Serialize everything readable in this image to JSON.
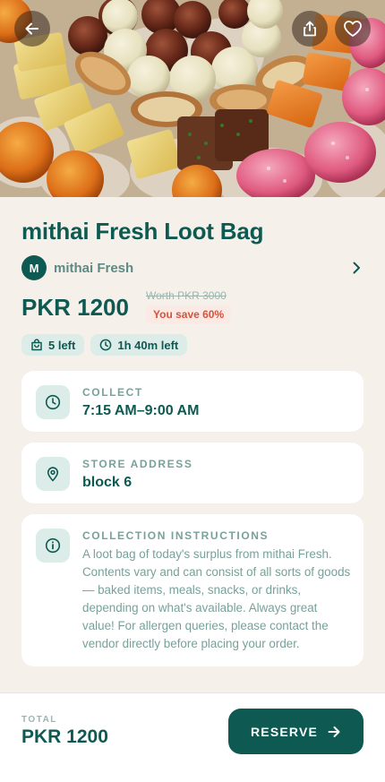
{
  "product": {
    "title": "mithai Fresh Loot Bag",
    "vendor": {
      "initial": "M",
      "name": "mithai Fresh"
    },
    "price": "PKR 1200",
    "worth": "Worth PKR 3000",
    "savings": "You save 60%",
    "chips": {
      "left": "5 left",
      "time_left": "1h 40m left"
    }
  },
  "details": {
    "collect": {
      "label": "COLLECT",
      "value": "7:15 AM–9:00 AM"
    },
    "address": {
      "label": "STORE ADDRESS",
      "value": "block 6"
    },
    "instructions": {
      "label": "COLLECTION INSTRUCTIONS",
      "text": "A loot bag of today's surplus from mithai Fresh. Contents vary and can consist of all sorts of goods — baked items, meals, snacks, or drinks, depending on what's available. Always great value! For allergen queries, please contact the vendor directly before placing your order."
    }
  },
  "footer": {
    "total_label": "TOTAL",
    "total_value": "PKR 1200",
    "reserve_label": "RESERVE"
  },
  "icons": {
    "back": "arrow-left-icon",
    "share": "share-icon",
    "favorite": "heart-icon",
    "vendor_chevron": "chevron-right-icon",
    "bag": "bag-icon",
    "clock": "clock-icon",
    "location": "map-pin-icon",
    "info": "info-icon",
    "reserve_arrow": "arrow-right-icon"
  },
  "colors": {
    "primary": "#0e5a52",
    "background": "#f6f0ea",
    "chip": "#dcece8",
    "savings_text": "#d9513d",
    "savings_bg": "#fbe9e4"
  }
}
